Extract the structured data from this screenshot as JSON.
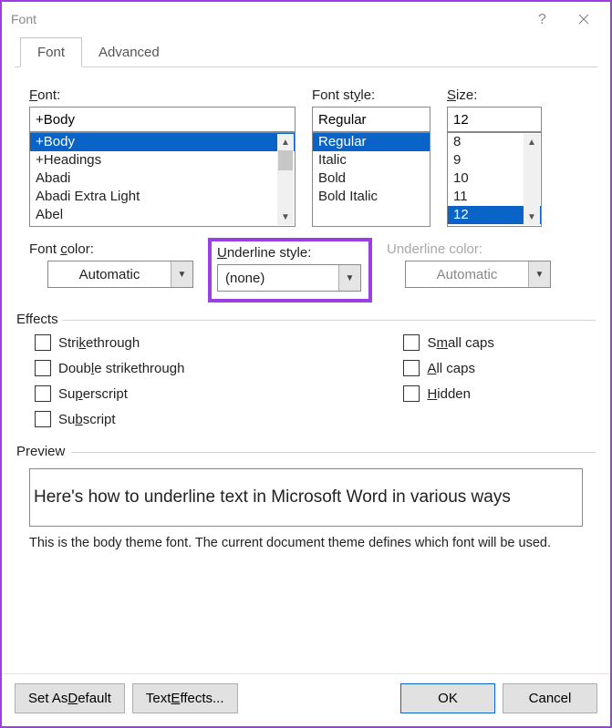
{
  "window": {
    "title": "Font"
  },
  "tabs": {
    "font": "Font",
    "advanced": "Advanced"
  },
  "labels": {
    "font": "Font:",
    "font_u": "F",
    "fontstyle": "Font style:",
    "fontstyle_u": "y",
    "size": "Size:",
    "size_u": "S",
    "fontcolor": "Font color:",
    "fontcolor_u": "c",
    "underlinestyle": "Underline style:",
    "underlinestyle_u": "U",
    "underlinecolor": "Underline color:",
    "effects": "Effects",
    "preview": "Preview"
  },
  "values": {
    "font": "+Body",
    "fontstyle": "Regular",
    "size": "12",
    "fontcolor": "Automatic",
    "underlinestyle": "(none)",
    "underlinecolor": "Automatic"
  },
  "lists": {
    "fonts": [
      "+Body",
      "+Headings",
      "Abadi",
      "Abadi Extra Light",
      "Abel"
    ],
    "fontstyles": [
      "Regular",
      "Italic",
      "Bold",
      "Bold Italic"
    ],
    "sizes": [
      "8",
      "9",
      "10",
      "11",
      "12"
    ]
  },
  "selected": {
    "font": "+Body",
    "fontstyle": "Regular",
    "size": "12"
  },
  "effects": {
    "strike": "Strikethrough",
    "strike_u": "k",
    "dstrike": "Double strikethrough",
    "dstrike_u": "l",
    "super": "Superscript",
    "super_u": "p",
    "sub": "Subscript",
    "sub_u": "b",
    "small": "Small caps",
    "small_u": "m",
    "all": "All caps",
    "all_u": "A",
    "hidden": "Hidden",
    "hidden_u": "H"
  },
  "preview": {
    "text": "Here's how to underline text in Microsoft Word in various ways",
    "desc": "This is the body theme font. The current document theme defines which font will be used."
  },
  "buttons": {
    "default": "Set As Default",
    "default_u": "D",
    "texteffects": "Text Effects...",
    "texteffects_u": "E",
    "ok": "OK",
    "cancel": "Cancel"
  }
}
